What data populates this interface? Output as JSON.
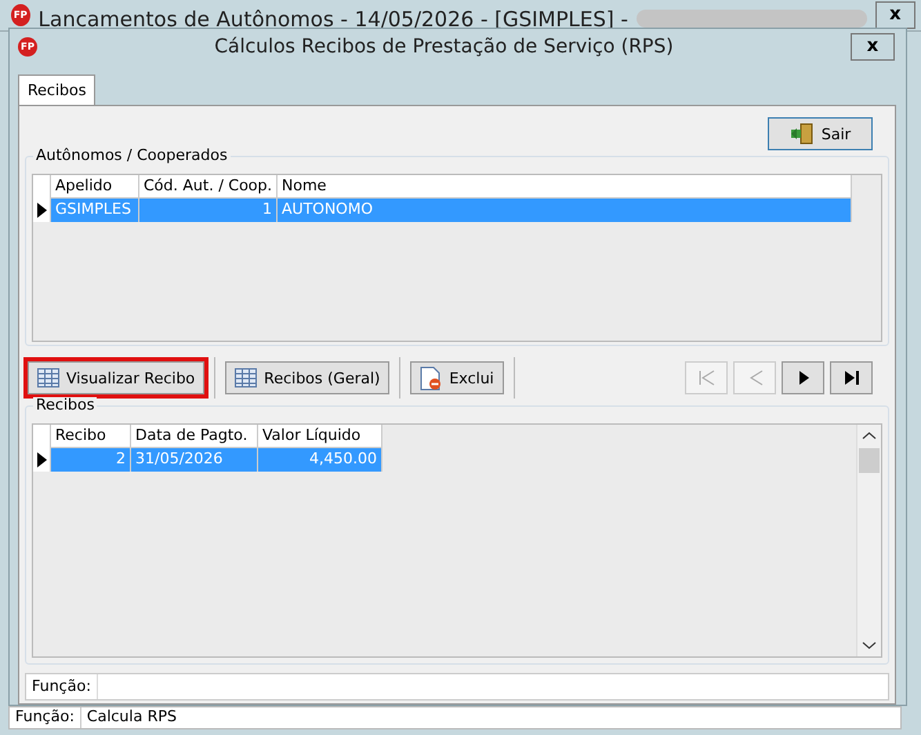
{
  "main_window": {
    "logo": "FP",
    "title": "Lancamentos de Autônomos -  14/05/2026 - [GSIMPLES] -",
    "close": "x",
    "status_label": "Função:",
    "status_value": "Calcula RPS"
  },
  "dialog": {
    "logo": "FP",
    "title": "Cálculos Recibos de Prestação de Serviço (RPS)",
    "close": "x"
  },
  "tabs": [
    {
      "label": "Recibos",
      "selected": true
    }
  ],
  "exit_button": "Sair",
  "autonomos": {
    "title": "Autônomos / Cooperados",
    "columns": [
      "Apelido",
      "Cód. Aut. / Coop.",
      "Nome"
    ],
    "rows": [
      {
        "cells": [
          "GSIMPLES",
          "1",
          "AUTONOMO"
        ],
        "selected": true
      }
    ]
  },
  "actions": [
    {
      "label": "Visualizar Recibo",
      "kind": "grid",
      "highlighted": true
    },
    {
      "label": "Recibos (Geral)",
      "kind": "grid",
      "highlighted": false
    },
    {
      "label": "Exclui",
      "kind": "delete",
      "highlighted": false
    }
  ],
  "navigation": [
    {
      "kind": "first",
      "disabled": true
    },
    {
      "kind": "prev",
      "disabled": true
    },
    {
      "kind": "next",
      "disabled": false
    },
    {
      "kind": "last",
      "disabled": false
    }
  ],
  "recibos": {
    "title": "Recibos",
    "columns": [
      "Recibo",
      "Data de Pagto.",
      "Valor Líquido"
    ],
    "rows": [
      {
        "cells": [
          "2",
          "31/05/2026",
          "4,450.00"
        ],
        "selected": true
      }
    ]
  },
  "function_field": {
    "label": "Função:"
  }
}
